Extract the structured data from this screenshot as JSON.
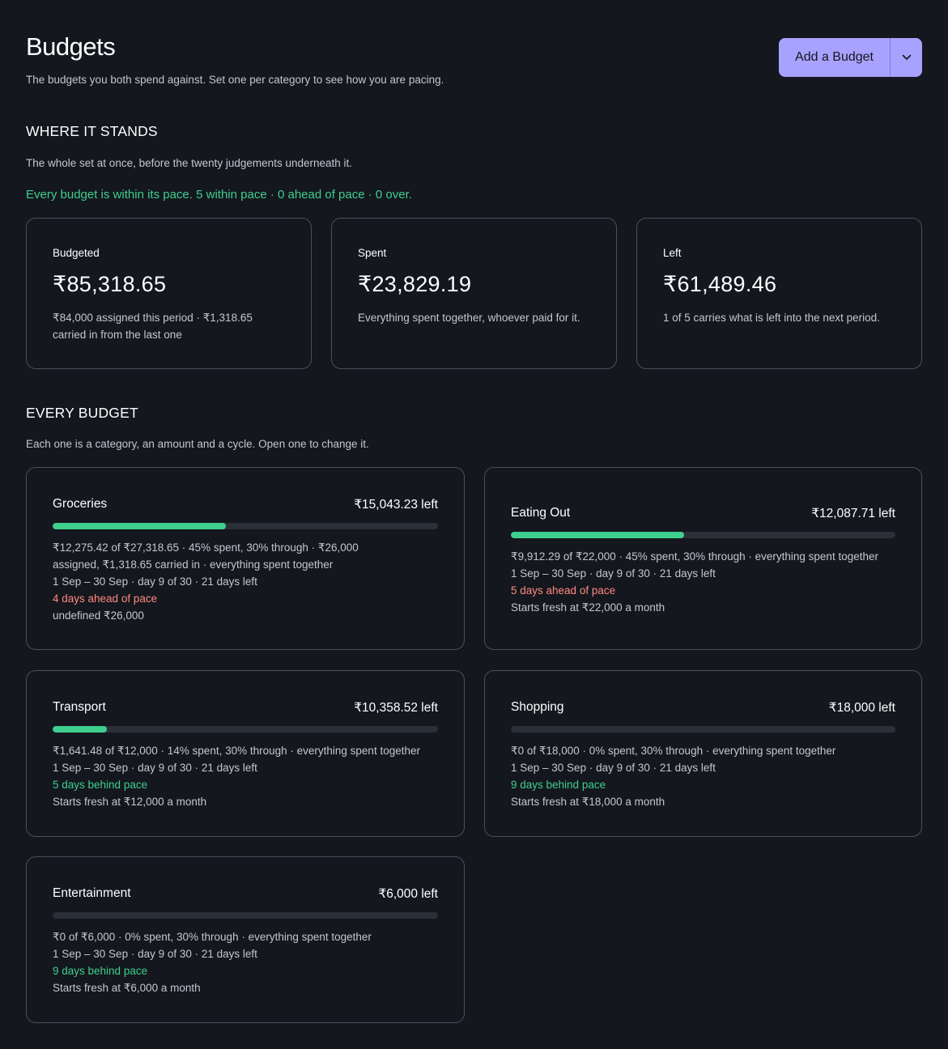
{
  "header": {
    "title": "Budgets",
    "subtitle": "The budgets you both spend against. Set one per category to see how you are pacing.",
    "add_button_label": "Add a Budget",
    "accent_color": "#a8a2ff"
  },
  "overview": {
    "title": "WHERE IT STANDS",
    "description": "The whole set at once, before the twenty judgements underneath it.",
    "status": "Every budget is within its pace. 5 within pace · 0 ahead of pace · 0 over.",
    "status_color": "#3ecf8e",
    "cards": [
      {
        "label": "Budgeted",
        "value": "₹85,318.65",
        "note": "₹84,000 assigned this period · ₹1,318.65 carried in from the last one"
      },
      {
        "label": "Spent",
        "value": "₹23,829.19",
        "note": "Everything spent together, whoever paid for it."
      },
      {
        "label": "Left",
        "value": "₹61,489.46",
        "note": "1 of 5 carries what is left into the next period."
      }
    ]
  },
  "budgets_section": {
    "title": "EVERY BUDGET",
    "description": "Each one is a category, an amount and a cycle. Open one to change it.",
    "items": [
      {
        "name": "Groceries",
        "left": "₹15,043.23 left",
        "progress": 0.45,
        "line1": "₹12,275.42 of ₹27,318.65 · 45% spent, 30% through · ₹26,000 assigned, ₹1,318.65 carried in · everything spent together",
        "line2": "1 Sep – 30 Sep · day 9 of 30 · 21 days left",
        "pace": "4 days ahead of pace",
        "pace_state": "ahead",
        "line4": "undefined ₹26,000"
      },
      {
        "name": "Eating Out",
        "left": "₹12,087.71 left",
        "progress": 0.45,
        "line1": "₹9,912.29 of ₹22,000 · 45% spent, 30% through · everything spent together",
        "line2": "1 Sep – 30 Sep · day 9 of 30 · 21 days left",
        "pace": "5 days ahead of pace",
        "pace_state": "ahead",
        "line4": "Starts fresh at ₹22,000 a month"
      },
      {
        "name": "Transport",
        "left": "₹10,358.52 left",
        "progress": 0.14,
        "line1": "₹1,641.48 of ₹12,000 · 14% spent, 30% through · everything spent together",
        "line2": "1 Sep – 30 Sep · day 9 of 30 · 21 days left",
        "pace": "5 days behind pace",
        "pace_state": "behind",
        "line4": "Starts fresh at ₹12,000 a month"
      },
      {
        "name": "Shopping",
        "left": "₹18,000 left",
        "progress": 0,
        "line1": "₹0 of ₹18,000 · 0% spent, 30% through · everything spent together",
        "line2": "1 Sep – 30 Sep · day 9 of 30 · 21 days left",
        "pace": "9 days behind pace",
        "pace_state": "behind",
        "line4": "Starts fresh at ₹18,000 a month"
      },
      {
        "name": "Entertainment",
        "left": "₹6,000 left",
        "progress": 0,
        "line1": "₹0 of ₹6,000 · 0% spent, 30% through · everything spent together",
        "line2": "1 Sep – 30 Sep · day 9 of 30 · 21 days left",
        "pace": "9 days behind pace",
        "pace_state": "behind",
        "line4": "Starts fresh at ₹6,000 a month"
      }
    ]
  }
}
